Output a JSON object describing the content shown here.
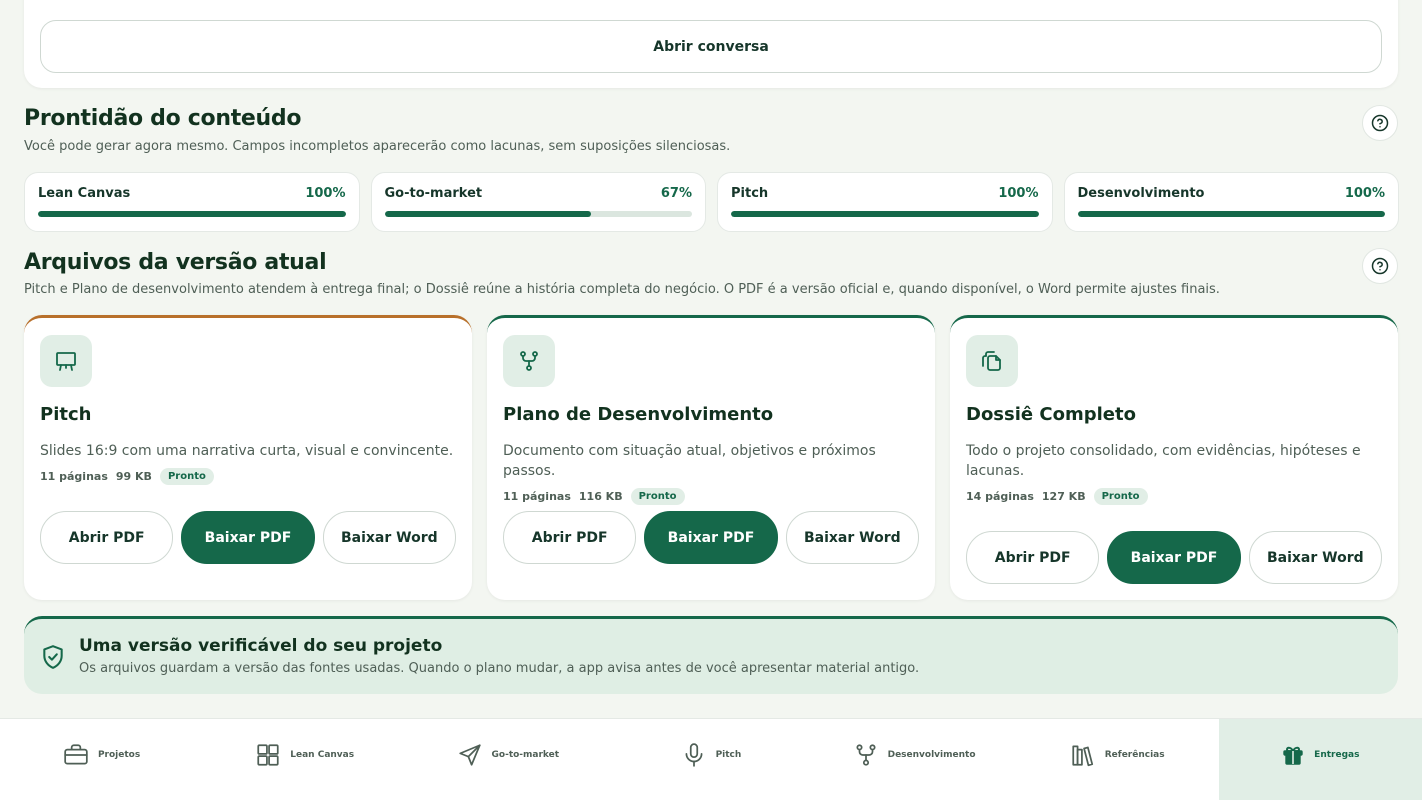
{
  "chat": {
    "open_label": "Abrir conversa"
  },
  "readiness": {
    "title": "Prontidão do conteúdo",
    "subtitle": "Você pode gerar agora mesmo. Campos incompletos aparecerão como lacunas, sem suposições silenciosas.",
    "help_icon": "help-circle-icon",
    "items": [
      {
        "label": "Lean Canvas",
        "percent_label": "100%",
        "value": 100
      },
      {
        "label": "Go-to-market",
        "percent_label": "67%",
        "value": 67
      },
      {
        "label": "Pitch",
        "percent_label": "100%",
        "value": 100
      },
      {
        "label": "Desenvolvimento",
        "percent_label": "100%",
        "value": 100
      }
    ]
  },
  "files": {
    "title": "Arquivos da versão atual",
    "subtitle": "Pitch e Plano de desenvolvimento atendem à entrega final; o Dossiê reúne a história completa do negócio. O PDF é a versão oficial e, quando disponível, o Word permite ajustes finais.",
    "cards": [
      {
        "icon": "presentation-icon",
        "accent": "#b8702b",
        "title": "Pitch",
        "description": "Slides 16:9 com uma narrativa curta, visual e convincente.",
        "pages": "11 páginas",
        "size": "99 KB",
        "status": "Pronto",
        "open_pdf": "Abrir PDF",
        "download_pdf": "Baixar PDF",
        "download_word": "Baixar Word"
      },
      {
        "icon": "git-fork-icon",
        "accent": "#15684a",
        "title": "Plano de Desenvolvimento",
        "description": "Documento com situação atual, objetivos e próximos passos.",
        "pages": "11 páginas",
        "size": "116 KB",
        "status": "Pronto",
        "open_pdf": "Abrir PDF",
        "download_pdf": "Baixar PDF",
        "download_word": "Baixar Word"
      },
      {
        "icon": "documents-icon",
        "accent": "#15684a",
        "title": "Dossiê Completo",
        "description": "Todo o projeto consolidado, com evidências, hipóteses e lacunas.",
        "pages": "14 páginas",
        "size": "127 KB",
        "status": "Pronto",
        "open_pdf": "Abrir PDF",
        "download_pdf": "Baixar PDF",
        "download_word": "Baixar Word"
      }
    ]
  },
  "verify": {
    "icon": "shield-check-icon",
    "title": "Uma versão verificável do seu projeto",
    "subtitle": "Os arquivos guardam a versão das fontes usadas. Quando o plano mudar, a app avisa antes de você apresentar material antigo."
  },
  "nav": {
    "items": [
      {
        "label": "Projetos",
        "icon": "briefcase-icon",
        "active": false
      },
      {
        "label": "Lean Canvas",
        "icon": "grid-icon",
        "active": false
      },
      {
        "label": "Go-to-market",
        "icon": "send-icon",
        "active": false
      },
      {
        "label": "Pitch",
        "icon": "microphone-icon",
        "active": false
      },
      {
        "label": "Desenvolvimento",
        "icon": "git-fork-icon",
        "active": false
      },
      {
        "label": "Referências",
        "icon": "library-icon",
        "active": false
      },
      {
        "label": "Entregas",
        "icon": "gift-icon",
        "active": true
      }
    ]
  },
  "colors": {
    "primary": "#15684a",
    "accent_orange": "#b8702b",
    "soft_green": "#e1eee6",
    "background": "#f3f6f1"
  }
}
